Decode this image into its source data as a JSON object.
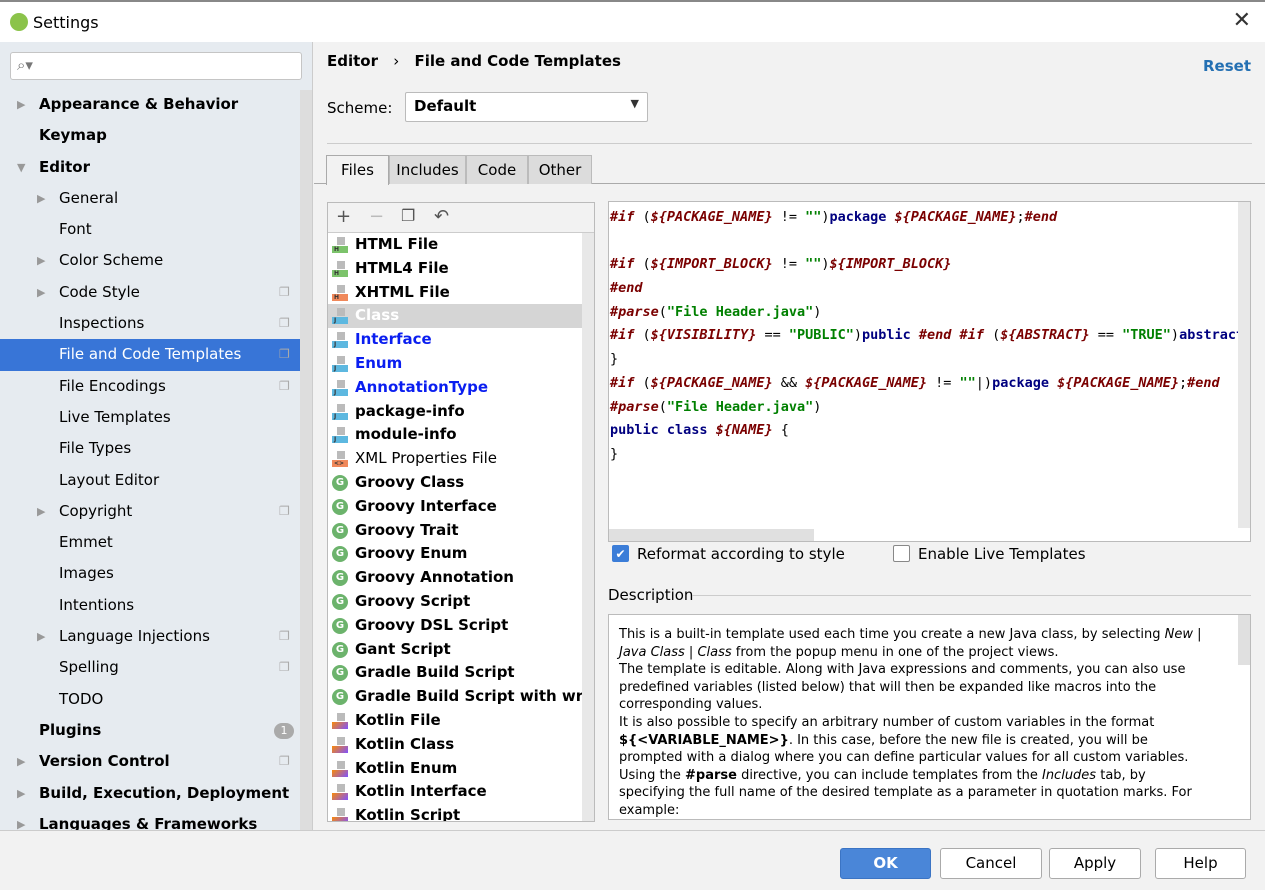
{
  "window": {
    "title": "Settings",
    "close_icon": "close-icon"
  },
  "search": {
    "placeholder": "",
    "value": ""
  },
  "sidebar": {
    "items": [
      {
        "label": "Appearance & Behavior",
        "level": 0,
        "expander": "collapsed",
        "bold": true
      },
      {
        "label": "Keymap",
        "level": 0,
        "bold": true
      },
      {
        "label": "Editor",
        "level": 0,
        "expander": "expanded",
        "bold": true
      },
      {
        "label": "General",
        "level": 1,
        "expander": "collapsed"
      },
      {
        "label": "Font",
        "level": 1
      },
      {
        "label": "Color Scheme",
        "level": 1,
        "expander": "collapsed"
      },
      {
        "label": "Code Style",
        "level": 1,
        "expander": "collapsed",
        "copy": true
      },
      {
        "label": "Inspections",
        "level": 1,
        "copy": true
      },
      {
        "label": "File and Code Templates",
        "level": 1,
        "copy": true,
        "selected": true
      },
      {
        "label": "File Encodings",
        "level": 1,
        "copy": true
      },
      {
        "label": "Live Templates",
        "level": 1
      },
      {
        "label": "File Types",
        "level": 1
      },
      {
        "label": "Layout Editor",
        "level": 1
      },
      {
        "label": "Copyright",
        "level": 1,
        "expander": "collapsed",
        "copy": true
      },
      {
        "label": "Emmet",
        "level": 1
      },
      {
        "label": "Images",
        "level": 1
      },
      {
        "label": "Intentions",
        "level": 1
      },
      {
        "label": "Language Injections",
        "level": 1,
        "expander": "collapsed",
        "copy": true
      },
      {
        "label": "Spelling",
        "level": 1,
        "copy": true
      },
      {
        "label": "TODO",
        "level": 1
      },
      {
        "label": "Plugins",
        "level": 0,
        "bold": true,
        "badge": "1"
      },
      {
        "label": "Version Control",
        "level": 0,
        "expander": "collapsed",
        "bold": true,
        "copy": true
      },
      {
        "label": "Build, Execution, Deployment",
        "level": 0,
        "expander": "collapsed",
        "bold": true
      },
      {
        "label": "Languages & Frameworks",
        "level": 0,
        "expander": "collapsed",
        "bold": true
      }
    ]
  },
  "header": {
    "breadcrumb": [
      "Editor",
      "File and Code Templates"
    ],
    "separator": "›",
    "reset": "Reset"
  },
  "scheme": {
    "label": "Scheme:",
    "value": "Default"
  },
  "tabs": [
    {
      "label": "Files",
      "active": true
    },
    {
      "label": "Includes"
    },
    {
      "label": "Code"
    },
    {
      "label": "Other"
    }
  ],
  "toolbar": {
    "add": "+",
    "remove": "−",
    "copy_icon": "copy-icon",
    "reset_icon": "undo-icon"
  },
  "templates": [
    {
      "label": "HTML File",
      "icon": "html",
      "style": "bold"
    },
    {
      "label": "HTML4 File",
      "icon": "html",
      "style": "bold"
    },
    {
      "label": "XHTML File",
      "icon": "xhtml",
      "style": "bold"
    },
    {
      "label": "Class",
      "icon": "java",
      "style": "bold",
      "selected": true
    },
    {
      "label": "Interface",
      "icon": "java",
      "style": "blue"
    },
    {
      "label": "Enum",
      "icon": "java",
      "style": "blue"
    },
    {
      "label": "AnnotationType",
      "icon": "java",
      "style": "blue"
    },
    {
      "label": "package-info",
      "icon": "java",
      "style": "bold"
    },
    {
      "label": "module-info",
      "icon": "java",
      "style": "bold"
    },
    {
      "label": "XML Properties File",
      "icon": "xml",
      "style": "normal"
    },
    {
      "label": "Groovy Class",
      "icon": "groovy",
      "style": "bold"
    },
    {
      "label": "Groovy Interface",
      "icon": "groovy",
      "style": "bold"
    },
    {
      "label": "Groovy Trait",
      "icon": "groovy",
      "style": "bold"
    },
    {
      "label": "Groovy Enum",
      "icon": "groovy",
      "style": "bold"
    },
    {
      "label": "Groovy Annotation",
      "icon": "groovy",
      "style": "bold"
    },
    {
      "label": "Groovy Script",
      "icon": "groovy",
      "style": "bold"
    },
    {
      "label": "Groovy DSL Script",
      "icon": "groovy",
      "style": "bold"
    },
    {
      "label": "Gant Script",
      "icon": "groovy",
      "style": "bold"
    },
    {
      "label": "Gradle Build Script",
      "icon": "groovy",
      "style": "bold"
    },
    {
      "label": "Gradle Build Script with wrapper",
      "icon": "groovy",
      "style": "bold"
    },
    {
      "label": "Kotlin File",
      "icon": "kotlin",
      "style": "bold"
    },
    {
      "label": "Kotlin Class",
      "icon": "kotlin",
      "style": "bold"
    },
    {
      "label": "Kotlin Enum",
      "icon": "kotlin",
      "style": "bold"
    },
    {
      "label": "Kotlin Interface",
      "icon": "kotlin",
      "style": "bold"
    },
    {
      "label": "Kotlin Script",
      "icon": "kotlin",
      "style": "bold"
    }
  ],
  "code_lines": [
    [
      [
        "d",
        "#if"
      ],
      [
        "p",
        " ("
      ],
      [
        "v",
        "${PACKAGE_NAME}"
      ],
      [
        "p",
        " != "
      ],
      [
        "s",
        "\"\""
      ],
      [
        "p",
        ")"
      ],
      [
        "k",
        "package "
      ],
      [
        "v",
        "${PACKAGE_NAME}"
      ],
      [
        "p",
        ";"
      ],
      [
        "d",
        "#end"
      ]
    ],
    [],
    [
      [
        "d",
        "#if"
      ],
      [
        "p",
        " ("
      ],
      [
        "v",
        "${IMPORT_BLOCK}"
      ],
      [
        "p",
        " != "
      ],
      [
        "s",
        "\"\""
      ],
      [
        "p",
        ")"
      ],
      [
        "v",
        "${IMPORT_BLOCK}"
      ]
    ],
    [
      [
        "d",
        "#end"
      ]
    ],
    [
      [
        "d",
        "#parse"
      ],
      [
        "p",
        "("
      ],
      [
        "s",
        "\"File Header.java\""
      ],
      [
        "p",
        ")"
      ]
    ],
    [
      [
        "d",
        "#if"
      ],
      [
        "p",
        " ("
      ],
      [
        "v",
        "${VISIBILITY}"
      ],
      [
        "p",
        " == "
      ],
      [
        "s",
        "\"PUBLIC\""
      ],
      [
        "p",
        ")"
      ],
      [
        "k",
        "public "
      ],
      [
        "d",
        "#end #if"
      ],
      [
        "p",
        " ("
      ],
      [
        "v",
        "${ABSTRACT}"
      ],
      [
        "p",
        " == "
      ],
      [
        "s",
        "\"TRUE\""
      ],
      [
        "p",
        ")"
      ],
      [
        "k",
        "abstract "
      ],
      [
        "d",
        "#"
      ]
    ],
    [
      [
        "p",
        "}"
      ]
    ],
    [
      [
        "d",
        "#if"
      ],
      [
        "p",
        " ("
      ],
      [
        "v",
        "${PACKAGE_NAME}"
      ],
      [
        "p",
        " && "
      ],
      [
        "v",
        "${PACKAGE_NAME}"
      ],
      [
        "p",
        " != "
      ],
      [
        "s",
        "\"\""
      ],
      [
        "p",
        "|)"
      ],
      [
        "k",
        "package "
      ],
      [
        "v",
        "${PACKAGE_NAME}"
      ],
      [
        "p",
        ";"
      ],
      [
        "d",
        "#end"
      ]
    ],
    [
      [
        "d",
        "#parse"
      ],
      [
        "p",
        "("
      ],
      [
        "s",
        "\"File Header.java\""
      ],
      [
        "p",
        ")"
      ]
    ],
    [
      [
        "k",
        "public class "
      ],
      [
        "v",
        "${NAME}"
      ],
      [
        "p",
        " {"
      ]
    ],
    [
      [
        "p",
        "}"
      ]
    ]
  ],
  "options": {
    "reformat": {
      "label": "Reformat according to style",
      "checked": true
    },
    "live_templates": {
      "label": "Enable Live Templates",
      "checked": false
    }
  },
  "description": {
    "label": "Description",
    "segments": [
      [
        "",
        "This is a built-in template used each time you create a new Java class, by selecting "
      ],
      [
        "i",
        "New | Java Class | Class"
      ],
      [
        "",
        " from the popup menu in one of the project views."
      ],
      [
        "br",
        ""
      ],
      [
        "",
        "The template is editable. Along with Java expressions and comments, you can also use predefined variables (listed below) that will then be expanded like macros into the corresponding values."
      ],
      [
        "br",
        ""
      ],
      [
        "",
        "It is also possible to specify an arbitrary number of custom variables in the format "
      ],
      [
        "b",
        "${<VARIABLE_NAME>}"
      ],
      [
        "",
        ". In this case, before the new file is created, you will be prompted with a dialog where you can define particular values for all custom variables."
      ],
      [
        "br",
        ""
      ],
      [
        "",
        "Using the "
      ],
      [
        "b",
        "#parse"
      ],
      [
        "",
        " directive, you can include templates from the "
      ],
      [
        "i",
        "Includes"
      ],
      [
        "",
        " tab, by specifying the full name of the desired template as a parameter in quotation marks. For example:"
      ]
    ]
  },
  "buttons": {
    "ok": "OK",
    "cancel": "Cancel",
    "apply": "Apply",
    "help": "Help"
  },
  "colors": {
    "selection": "#3875d7",
    "ok_button": "#4a86d8",
    "link": "#2470b3",
    "string": "#008000",
    "directive": "#7a0000",
    "keyword": "#000080"
  }
}
